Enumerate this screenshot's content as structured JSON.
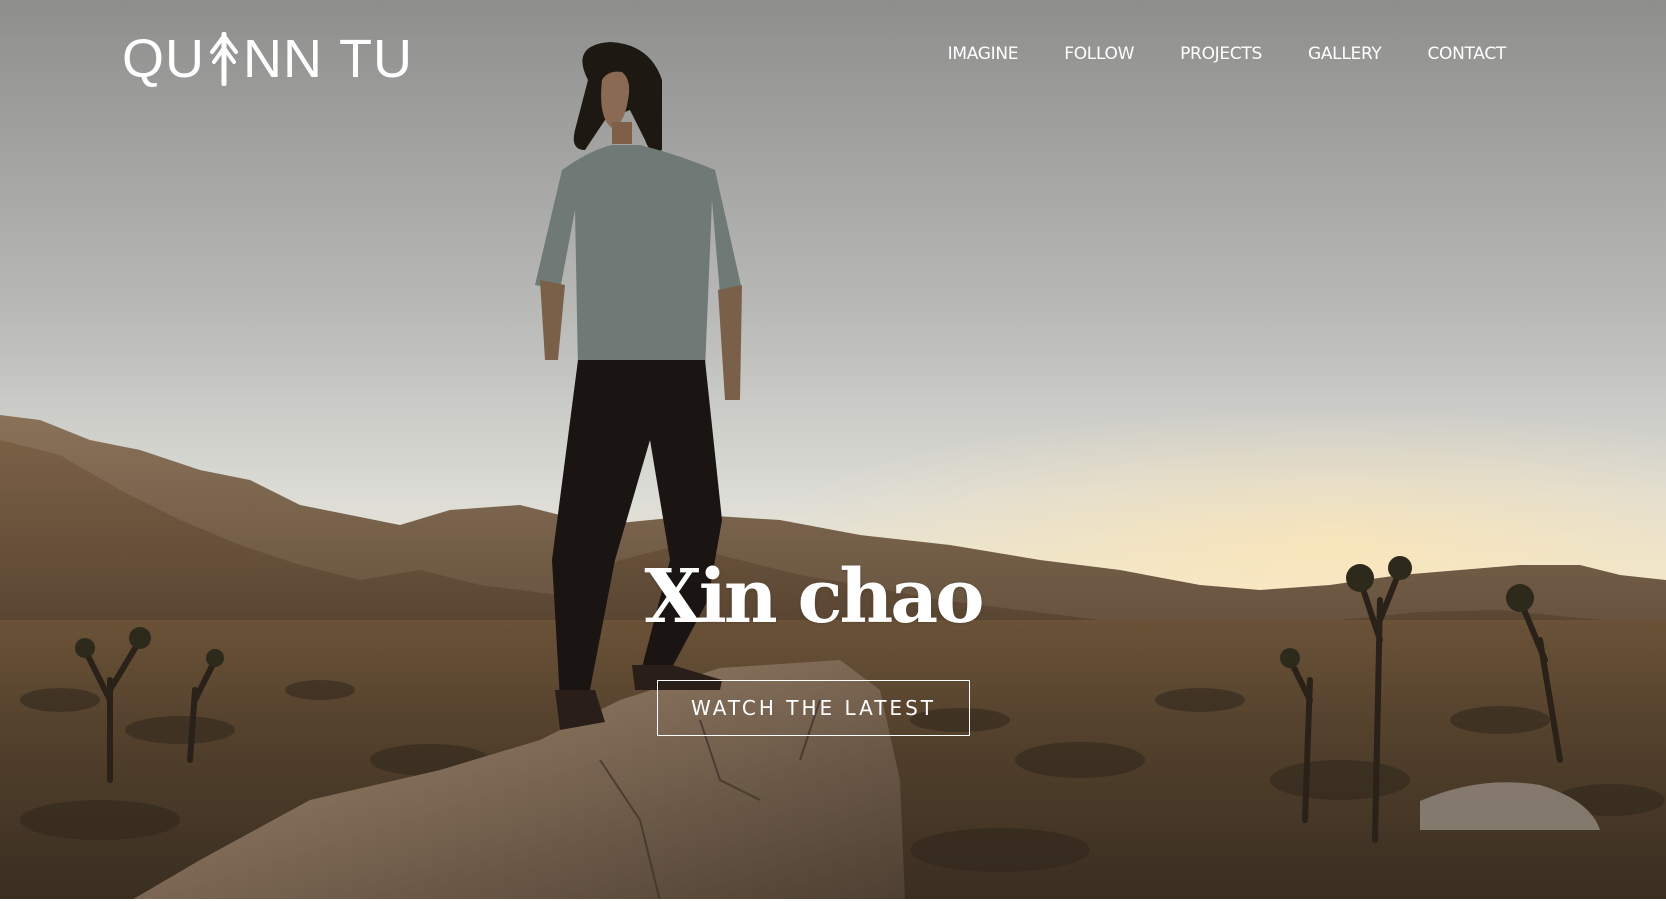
{
  "brand": {
    "name_part1": "QU",
    "name_part2": "NN",
    "name_part3": "TU",
    "icon": "pine-tree-icon"
  },
  "nav": {
    "items": [
      {
        "label": "IMAGINE"
      },
      {
        "label": "FOLLOW"
      },
      {
        "label": "PROJECTS"
      },
      {
        "label": "GALLERY"
      },
      {
        "label": "CONTACT"
      }
    ]
  },
  "hero": {
    "headline": "Xin chao",
    "cta_label": "WATCH THE LATEST"
  },
  "colors": {
    "text": "#ffffff",
    "sky_top": "#8f8f8d",
    "sky_horizon": "#efe6cf",
    "ground": "#5a4531"
  }
}
